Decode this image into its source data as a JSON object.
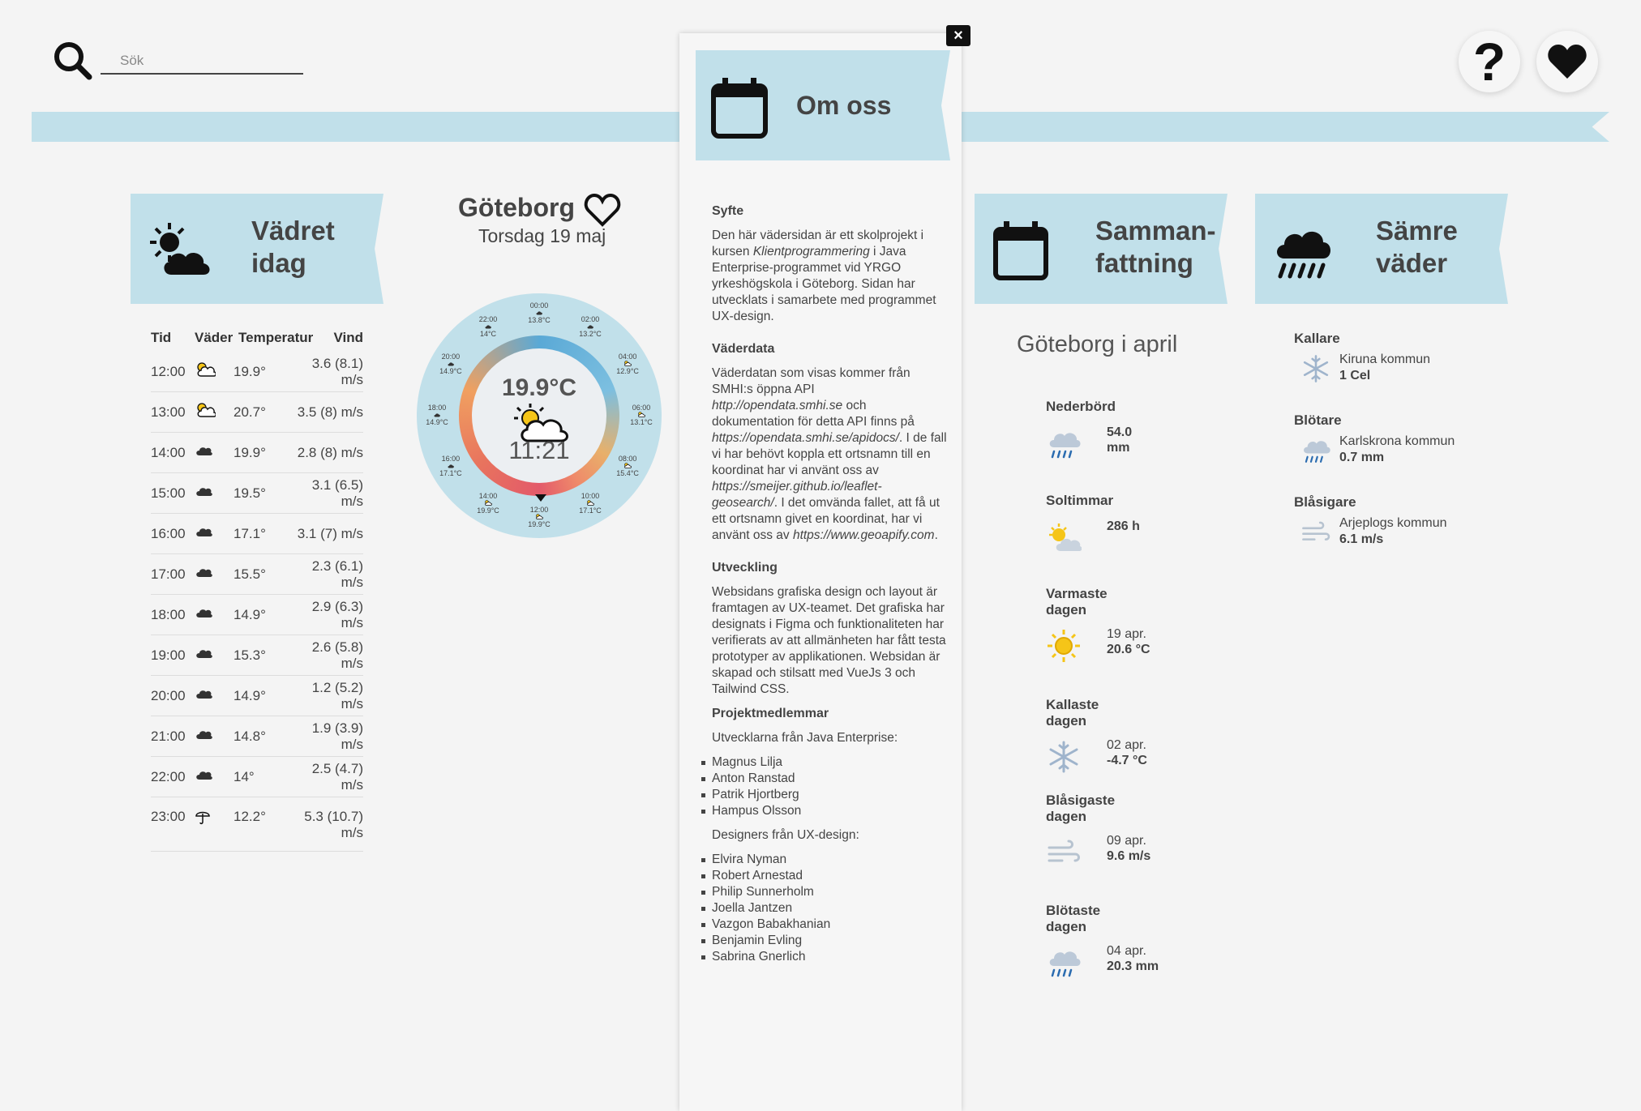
{
  "header": {
    "search_placeholder": "Sök",
    "help_label": "?"
  },
  "today": {
    "title": "Vädret idag",
    "columns": [
      "Tid",
      "Väder",
      "Temperatur",
      "Vind"
    ],
    "rows": [
      {
        "time": "12:00",
        "icon": "sun-cloud-icon",
        "temp": "19.9°",
        "wind": "3.6 (8.1) m/s"
      },
      {
        "time": "13:00",
        "icon": "sun-cloud-icon",
        "temp": "20.7°",
        "wind": "3.5 (8) m/s"
      },
      {
        "time": "14:00",
        "icon": "cloud-icon",
        "temp": "19.9°",
        "wind": "2.8 (8) m/s"
      },
      {
        "time": "15:00",
        "icon": "cloud-icon",
        "temp": "19.5°",
        "wind": "3.1 (6.5) m/s"
      },
      {
        "time": "16:00",
        "icon": "cloud-icon",
        "temp": "17.1°",
        "wind": "3.1 (7) m/s"
      },
      {
        "time": "17:00",
        "icon": "cloud-icon",
        "temp": "15.5°",
        "wind": "2.3 (6.1) m/s"
      },
      {
        "time": "18:00",
        "icon": "cloud-icon",
        "temp": "14.9°",
        "wind": "2.9 (6.3) m/s"
      },
      {
        "time": "19:00",
        "icon": "cloud-icon",
        "temp": "15.3°",
        "wind": "2.6 (5.8) m/s"
      },
      {
        "time": "20:00",
        "icon": "cloud-icon",
        "temp": "14.9°",
        "wind": "1.2 (5.2) m/s"
      },
      {
        "time": "21:00",
        "icon": "cloud-icon",
        "temp": "14.8°",
        "wind": "1.9 (3.9) m/s"
      },
      {
        "time": "22:00",
        "icon": "cloud-icon",
        "temp": "14°",
        "wind": "2.5 (4.7) m/s"
      },
      {
        "time": "23:00",
        "icon": "umbrella-icon",
        "temp": "12.2°",
        "wind": "5.3 (10.7) m/s"
      }
    ]
  },
  "city": {
    "name": "Göteborg",
    "date": "Torsdag 19 maj",
    "current_temp": "19.9°C",
    "current_time": "11:21",
    "clock_hours": [
      {
        "time": "00:00",
        "temp": "13.8°C"
      },
      {
        "time": "02:00",
        "temp": "13.2°C"
      },
      {
        "time": "04:00",
        "temp": "12.9°C"
      },
      {
        "time": "06:00",
        "temp": "13.1°C"
      },
      {
        "time": "08:00",
        "temp": "15.4°C"
      },
      {
        "time": "10:00",
        "temp": "17.1°C"
      },
      {
        "time": "12:00",
        "temp": "19.9°C"
      },
      {
        "time": "14:00",
        "temp": "19.9°C"
      },
      {
        "time": "16:00",
        "temp": "17.1°C"
      },
      {
        "time": "18:00",
        "temp": "14.9°C"
      },
      {
        "time": "20:00",
        "temp": "14.9°C"
      },
      {
        "time": "22:00",
        "temp": "14°C"
      }
    ]
  },
  "summary": {
    "title": "Sammanfattning",
    "subtitle": "Göteborg i april",
    "items": [
      {
        "label": "Nederbörd",
        "line1": "54.0",
        "line2": "mm"
      },
      {
        "label": "Soltimmar",
        "line1": "286 h",
        "line2": ""
      },
      {
        "label": "Varmaste dagen",
        "line1": "19 apr.",
        "line2": "20.6 °C"
      },
      {
        "label": "Kallaste dagen",
        "line1": "02 apr.",
        "line2": "-4.7 °C"
      },
      {
        "label": "Blåsigaste dagen",
        "line1": "09 apr.",
        "line2": "9.6 m/s"
      },
      {
        "label": "Blötaste dagen",
        "line1": "04 apr.",
        "line2": "20.3 mm"
      }
    ]
  },
  "worse": {
    "title": "Sämre väder",
    "items": [
      {
        "label": "Kallare",
        "place": "Kiruna kommun",
        "value": "1 Cel"
      },
      {
        "label": "Blötare",
        "place": "Karlskrona kommun",
        "value": "0.7 mm"
      },
      {
        "label": "Blåsigare",
        "place": "Arjeplogs kommun",
        "value": "6.1 m/s"
      }
    ]
  },
  "modal": {
    "close_label": "×",
    "title": "Om oss",
    "syfte_title": "Syfte",
    "syfte_a": "Den här vädersidan är ett skolprojekt i kursen ",
    "syfte_em": "Klientprogrammering",
    "syfte_b": " i Java Enterprise-programmet vid YRGO yrkeshögskola i Göteborg. Sidan har utvecklats i samarbete med programmet UX-design.",
    "data_title": "Väderdata",
    "data_a": "Väderdatan som visas kommer från SMHI:s öppna API ",
    "data_link1": "http://opendata.smhi.se",
    "data_b": " och dokumentation för detta API finns på ",
    "data_link2": "https://opendata.smhi.se/apidocs/",
    "data_c": ". I de fall vi har behövt koppla ett ortsnamn till en koordinat har vi använt oss av ",
    "data_link3": "https://smeijer.github.io/leaflet-geosearch/",
    "data_d": ". I det omvända fallet, att få ut ett ortsnamn givet en koordinat, har vi använt oss av ",
    "data_link4": "https://www.geoapify.com",
    "data_e": ".",
    "dev_title": "Utveckling",
    "dev_text": "Websidans grafiska design och layout är framtagen av UX-teamet. Det grafiska har designats i Figma och funktionaliteten har verifierats av att allmänheten har fått testa prototyper av applikationen. Websidan är skapad och stilsatt med VueJs 3 och Tailwind CSS.",
    "members_title": "Projektmedlemmar",
    "java_intro": "Utvecklarna från Java Enterprise:",
    "java_members": [
      "Magnus Lilja",
      "Anton Ranstad",
      "Patrik Hjortberg",
      "Hampus Olsson"
    ],
    "ux_intro": "Designers från UX-design:",
    "ux_members": [
      "Elvira Nyman",
      "Robert Arnestad",
      "Philip Sunnerholm",
      "Joella Jantzen",
      "Vazgon Babakhanian",
      "Benjamin Evling",
      "Sabrina Gnerlich"
    ]
  },
  "colors": {
    "ribbon": "#c1e0ea",
    "sun": "#f5c518",
    "rain_cloud": "#8fb0d0"
  }
}
